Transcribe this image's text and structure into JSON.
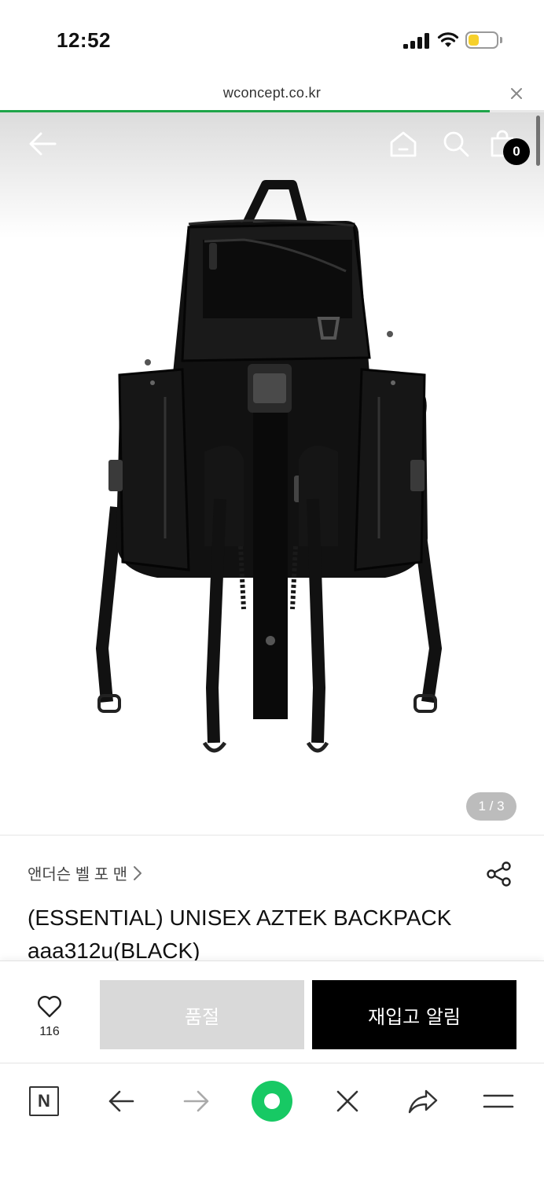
{
  "status_bar": {
    "time": "12:52"
  },
  "url_bar": {
    "url": "wconcept.co.kr",
    "load_progress": 0.9
  },
  "header": {
    "cart_count": "0"
  },
  "gallery": {
    "counter": "1 / 3"
  },
  "product": {
    "brand": "앤더슨 벨 포 맨",
    "name_line1": "(ESSENTIAL) UNISEX AZTEK BACKPACK",
    "name_line2": "aaa312u(BLACK)"
  },
  "actions": {
    "wish_count": "116",
    "soldout_label": "품절",
    "restock_label": "재입고 알림"
  },
  "browser_toolbar": {
    "naver_label": "N"
  },
  "colors": {
    "accent_green": "#17c964",
    "progress_green": "#1fa54a",
    "soldout_bg": "#d9d9d9",
    "primary_btn": "#000000"
  },
  "icons": [
    "back-arrow-icon",
    "home-icon",
    "search-icon",
    "shopping-bag-icon",
    "chevron-right-icon",
    "share-icon",
    "heart-icon",
    "close-icon",
    "forward-arrow-icon",
    "menu-icon"
  ]
}
